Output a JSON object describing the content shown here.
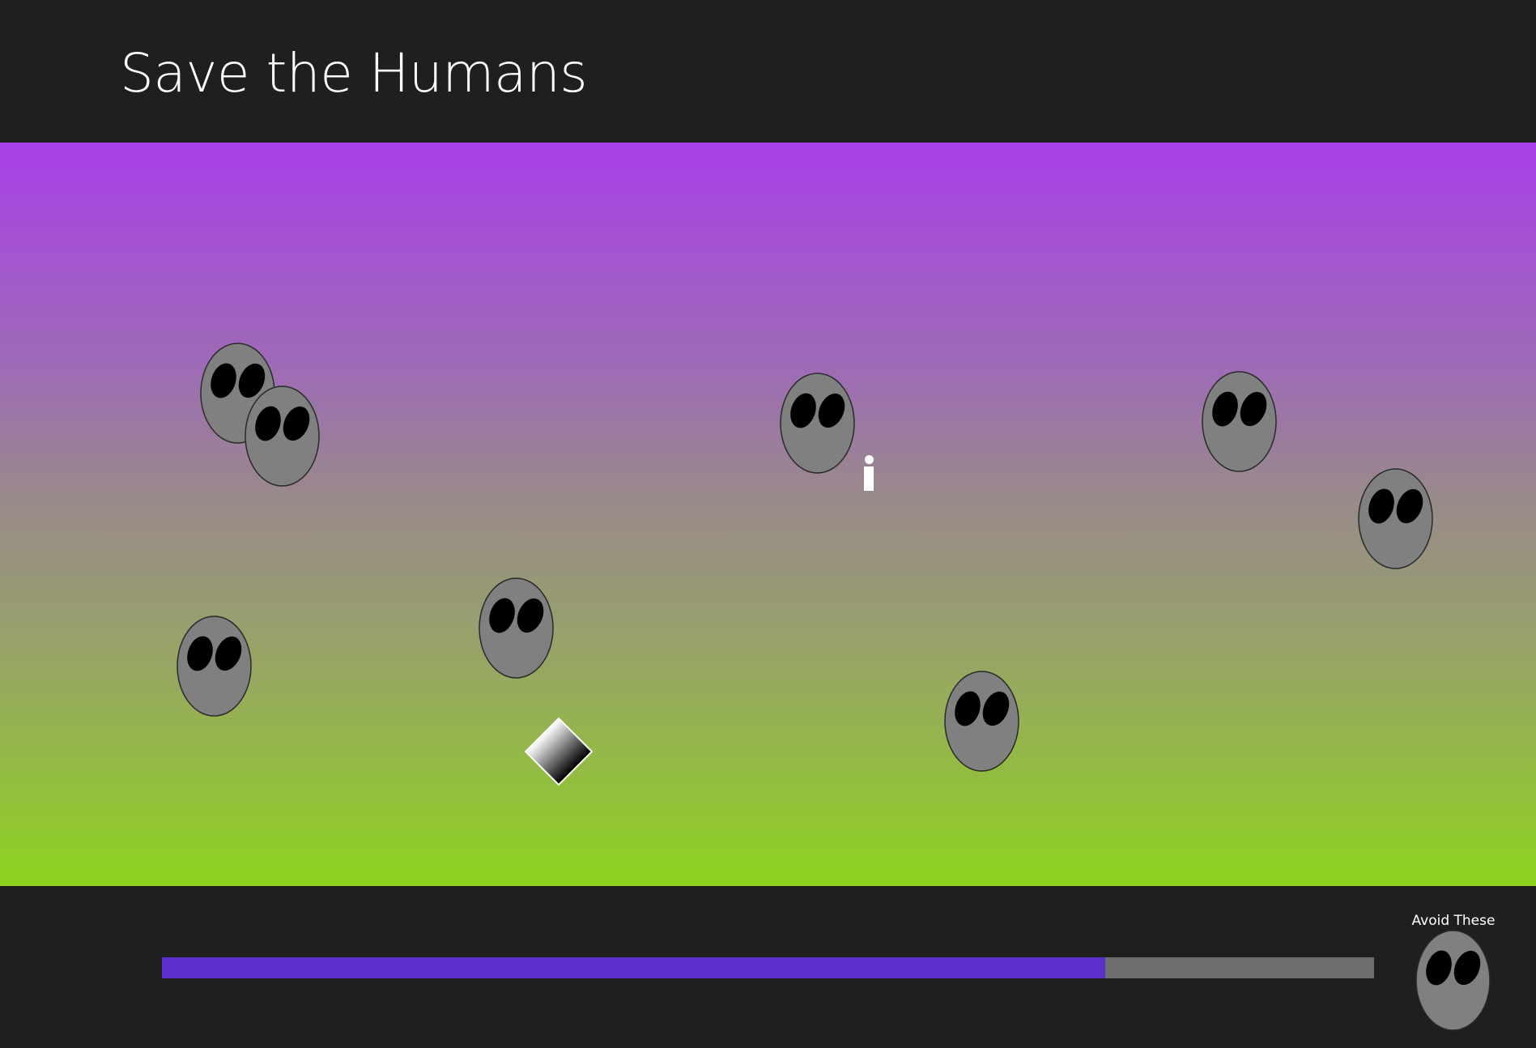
{
  "header": {
    "title": "Save the Humans"
  },
  "footer": {
    "legend_label": "Avoid These",
    "progress": 0.778
  },
  "colors": {
    "play_area_top": "#a83fe8",
    "play_area_bottom": "#8ed31f",
    "progress_fill": "#5b2fcb",
    "progress_track": "#6d6d6d",
    "enemy_face": "#808080",
    "enemy_eye": "#000000"
  },
  "icons": {
    "enemy": "enemy-icon",
    "human": "human-icon",
    "target": "target-portal-icon"
  }
}
